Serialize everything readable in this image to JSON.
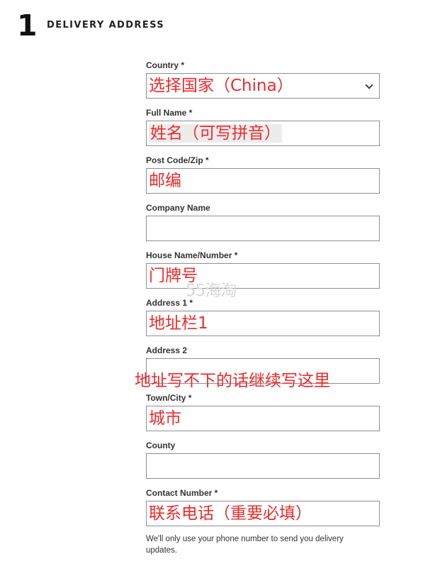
{
  "section": {
    "number": "1",
    "title": "DELIVERY ADDRESS"
  },
  "fields": {
    "country": {
      "label": "Country *",
      "annotation": "选择国家（China）"
    },
    "full_name": {
      "label": "Full Name *",
      "annotation": "姓名（可写拼音）"
    },
    "post_code": {
      "label": "Post Code/Zip *",
      "annotation": "邮编"
    },
    "company": {
      "label": "Company Name",
      "annotation": ""
    },
    "house": {
      "label": "House Name/Number *",
      "annotation": "门牌号"
    },
    "address1": {
      "label": "Address 1 *",
      "annotation": "地址栏1"
    },
    "address2": {
      "label": "Address 2",
      "annotation": "地址写不下的话继续写这里"
    },
    "town": {
      "label": "Town/City *",
      "annotation": "城市"
    },
    "county": {
      "label": "County",
      "annotation": ""
    },
    "contact": {
      "label": "Contact Number *",
      "annotation": "联系电话（重要必填）"
    }
  },
  "helper_text": "We'll only use your phone number to send you delivery updates.",
  "watermark": "55海淘",
  "colors": {
    "annotation": "#ee2a2a",
    "border": "#8f8f8f",
    "watermark": "#d8d8d8"
  },
  "icons": {
    "select_arrow": "chevron-down-icon"
  }
}
